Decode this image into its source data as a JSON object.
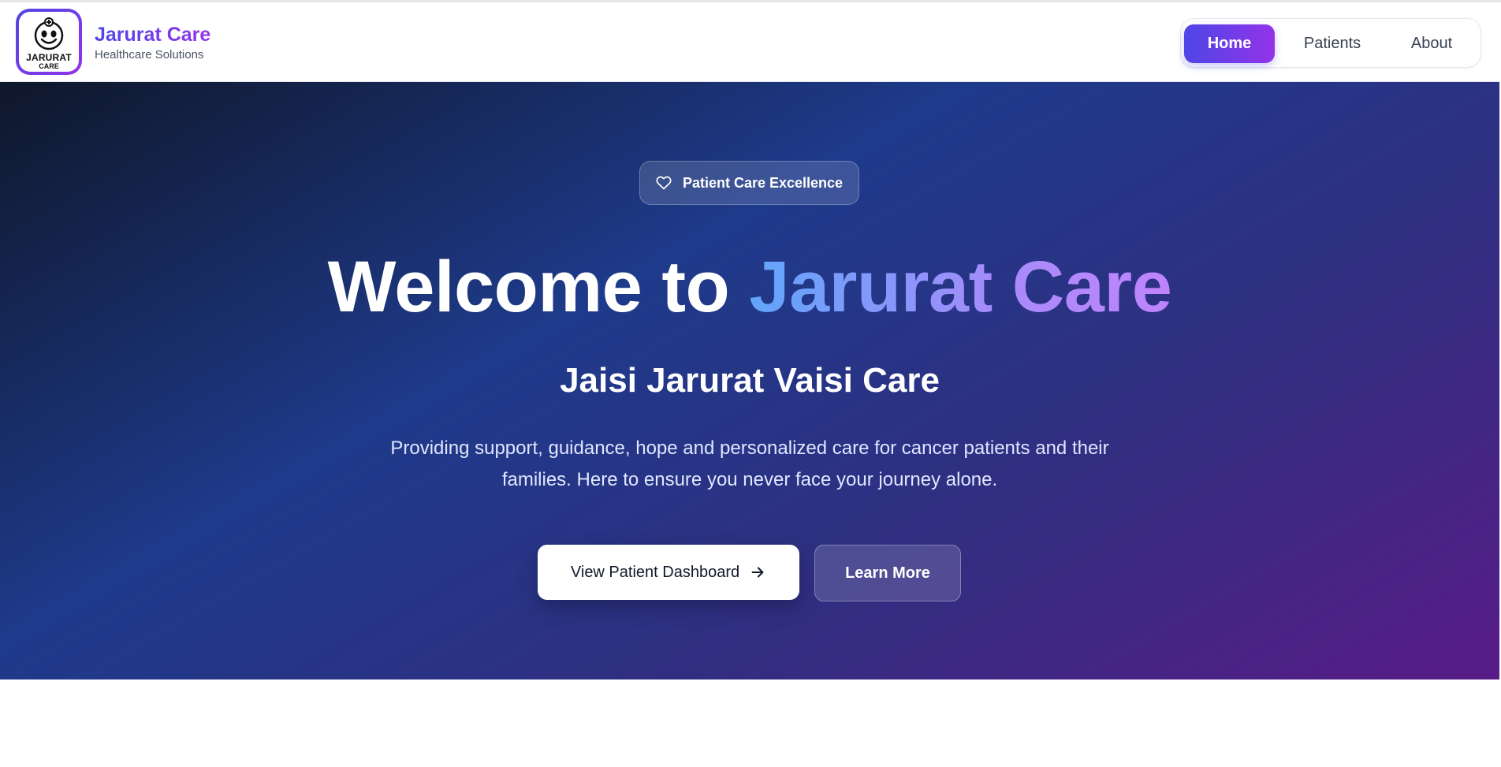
{
  "brand": {
    "logo_line1": "JARURAT",
    "logo_line2": "CARE",
    "name": "Jarurat Care",
    "subtitle": "Healthcare Solutions"
  },
  "nav": {
    "items": [
      {
        "label": "Home",
        "active": true
      },
      {
        "label": "Patients",
        "active": false
      },
      {
        "label": "About",
        "active": false
      }
    ]
  },
  "hero": {
    "badge": "Patient Care Excellence",
    "title_prefix": "Welcome to",
    "title_accent": "Jarurat Care",
    "tagline": "Jaisi Jarurat Vaisi Care",
    "description": "Providing support, guidance, hope and personalized care for cancer patients and their families. Here to ensure you never face your journey alone.",
    "primary_button": "View Patient Dashboard",
    "secondary_button": "Learn More"
  },
  "colors": {
    "brand_start": "#4f46e5",
    "brand_end": "#9333ea",
    "hero_dark": "#0f172a",
    "hero_mid": "#1e3a8a",
    "hero_end": "#581c87"
  },
  "icons": [
    "heart-icon",
    "arrow-right-icon",
    "logo-face-icon"
  ]
}
